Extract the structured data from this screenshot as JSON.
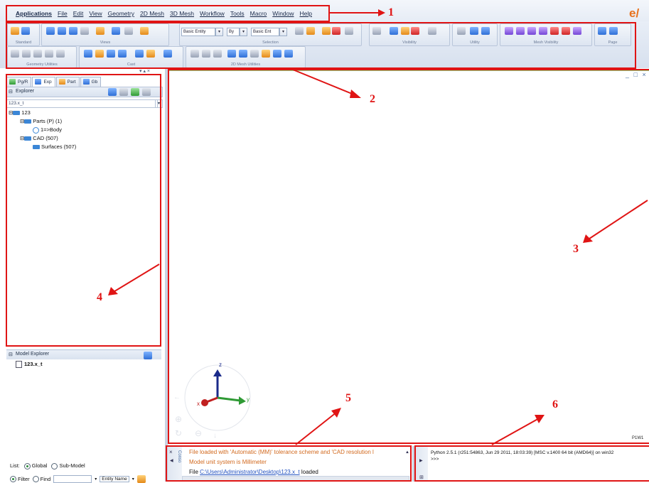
{
  "menu": {
    "items": [
      "Applications",
      "File",
      "Edit",
      "View",
      "Geometry",
      "2D Mesh",
      "3D Mesh",
      "Workflow",
      "Tools",
      "Macro",
      "Window",
      "Help"
    ]
  },
  "toolbar": {
    "groups": [
      "Standard",
      "Views",
      "Selection",
      "Visibility",
      "Utility",
      "Mesh Visibility",
      "Page",
      "Geometry Utilities",
      "Cast",
      "2D Mesh Utilities"
    ],
    "combos": [
      "Basic Entity",
      "By",
      "Basic Ent"
    ]
  },
  "left_panel": {
    "tabs": [
      "Pg/R",
      "Exp",
      "Part",
      "Gb"
    ],
    "explorer_title": "Explorer",
    "filter_value": "123.x_t",
    "tree": [
      "123",
      "Parts (P) (1)",
      "1=>Body",
      "CAD (507)",
      "Surfaces (507)"
    ],
    "model_explorer_title": "Model Explorer",
    "model_item": "123.x_t",
    "list_label": "List:",
    "list_options": [
      "Global",
      "Sub-Model"
    ],
    "filter_options": [
      "Filter",
      "Find"
    ],
    "entity_name": "Entity Name"
  },
  "viewport": {
    "window_controls": "_ □ ×",
    "corner_label": "P1W1",
    "axes": [
      "z",
      "x",
      "y"
    ]
  },
  "messages": {
    "side_label": "Conso",
    "lines": [
      "File loaded with 'Automatic (MM)' tolerance scheme and 'CAD resolution l",
      "Model unit system is Millimeter",
      "File",
      "C:\\Users\\Administrator\\Desktop\\123.x_t",
      "loaded"
    ]
  },
  "python": {
    "lines": [
      "Python 2.5.1 (r251:54863, Jun 29 2011, 18:03:39) [MSC v.1400 64 bit (AMD64)] on win32",
      ">>>"
    ]
  },
  "annotations": [
    "1",
    "2",
    "3",
    "4",
    "5",
    "6"
  ],
  "colors": {
    "annotation": "#e01414",
    "logo": "#e8711c",
    "message_orange": "#d2691e",
    "link": "#1f4fbf"
  }
}
